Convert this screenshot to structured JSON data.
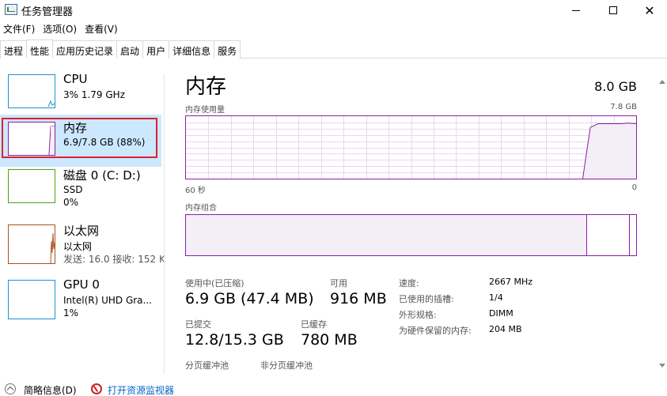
{
  "window": {
    "title": "任务管理器"
  },
  "menu": [
    "文件(F)",
    "选项(O)",
    "查看(V)"
  ],
  "tabs": [
    "进程",
    "性能",
    "应用历史记录",
    "启动",
    "用户",
    "详细信息",
    "服务"
  ],
  "resources": [
    {
      "title": "CPU",
      "sub1": "3%  1.79 GHz",
      "color": "#1f91cc"
    },
    {
      "title": "内存",
      "sub1": "6.9/7.8 GB (88%)",
      "color": "#8b1fa6"
    },
    {
      "title": "磁盘 0 (C: D:)",
      "sub1": "SSD",
      "sub2": "0%",
      "color": "#4ca30a"
    },
    {
      "title": "以太网",
      "sub1": "以太网",
      "sub2": "发送: 16.0  接收: 152 K",
      "color": "#a7541c"
    },
    {
      "title": "GPU 0",
      "sub1": "Intel(R) UHD Gra...",
      "sub2": "1%",
      "color": "#1f91cc"
    }
  ],
  "main": {
    "title": "内存",
    "total": "8.0 GB",
    "usage_label": "内存使用量",
    "usage_max": "7.8 GB",
    "time_left": "60 秒",
    "time_right": "0",
    "composition_label": "内存组合",
    "usage_history_percent": [
      0,
      0,
      0,
      0,
      0,
      0,
      0,
      0,
      0,
      0,
      0,
      0,
      0,
      0,
      0,
      0,
      0,
      0,
      0,
      0,
      0,
      0,
      0,
      0,
      0,
      0,
      0,
      0,
      0,
      0,
      0,
      0,
      0,
      0,
      0,
      0,
      0,
      0,
      0,
      0,
      0,
      0,
      0,
      0,
      0,
      0,
      0,
      0,
      0,
      0,
      0,
      0,
      0,
      82,
      88,
      88,
      88,
      88,
      89,
      88
    ],
    "stats": {
      "in_use_label": "使用中(已压缩)",
      "in_use_value": "6.9 GB (47.4 MB)",
      "available_label": "可用",
      "available_value": "916 MB",
      "committed_label": "已提交",
      "committed_value": "12.8/15.3 GB",
      "cached_label": "已缓存",
      "cached_value": "780 MB",
      "paged_pool_label": "分页缓冲池",
      "nonpaged_pool_label": "非分页缓冲池"
    },
    "details": [
      {
        "label": "速度:",
        "value": "2667 MHz"
      },
      {
        "label": "已使用的插槽:",
        "value": "1/4"
      },
      {
        "label": "外形规格:",
        "value": "DIMM"
      },
      {
        "label": "为硬件保留的内存:",
        "value": "204 MB"
      }
    ]
  },
  "footer": {
    "summary": "简略信息(D)",
    "monitor": "打开资源监视器"
  }
}
